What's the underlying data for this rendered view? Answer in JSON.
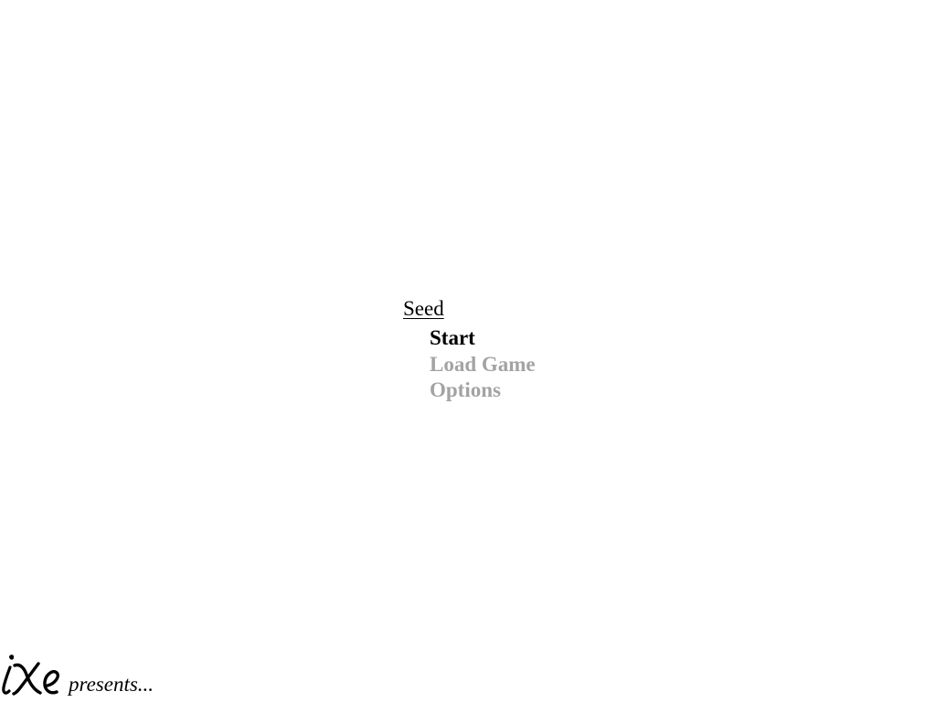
{
  "game": {
    "title": "Seed"
  },
  "menu": {
    "items": [
      {
        "label": "Start",
        "state": "selected"
      },
      {
        "label": "Load Game",
        "state": "disabled"
      },
      {
        "label": "Options",
        "state": "disabled"
      }
    ]
  },
  "footer": {
    "logo_text": "iXe",
    "presents_text": "presents..."
  },
  "colors": {
    "background": "#ffffff",
    "selected": "#000000",
    "disabled": "#a3a3a3"
  }
}
